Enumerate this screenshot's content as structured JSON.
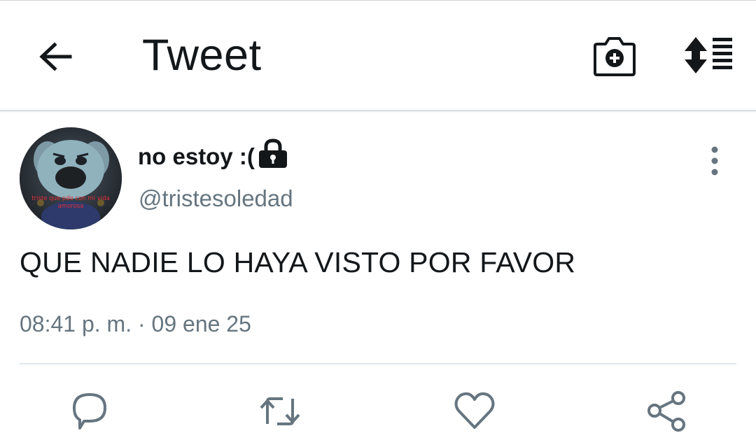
{
  "header": {
    "title": "Tweet",
    "icons": {
      "back": "arrow-left-icon",
      "camera": "camera-add-icon",
      "sort": "sort-list-icon"
    }
  },
  "tweet": {
    "author": {
      "display_name": "no estoy :(",
      "handle": "@tristesoledad",
      "locked": true,
      "avatar_caption": "triste que pdo con mi vida amorosa"
    },
    "text": "QUE NADIE LO HAYA VISTO POR FAVOR",
    "timestamp": "08:41 p. m. · 09 ene 25"
  },
  "actions": {
    "reply": "reply-icon",
    "retweet": "retweet-icon",
    "like": "heart-icon",
    "share": "share-icon"
  },
  "colors": {
    "text": "#14171a",
    "secondary": "#66757f",
    "divider": "#e1e8ed",
    "icon_gray": "#66757f"
  }
}
